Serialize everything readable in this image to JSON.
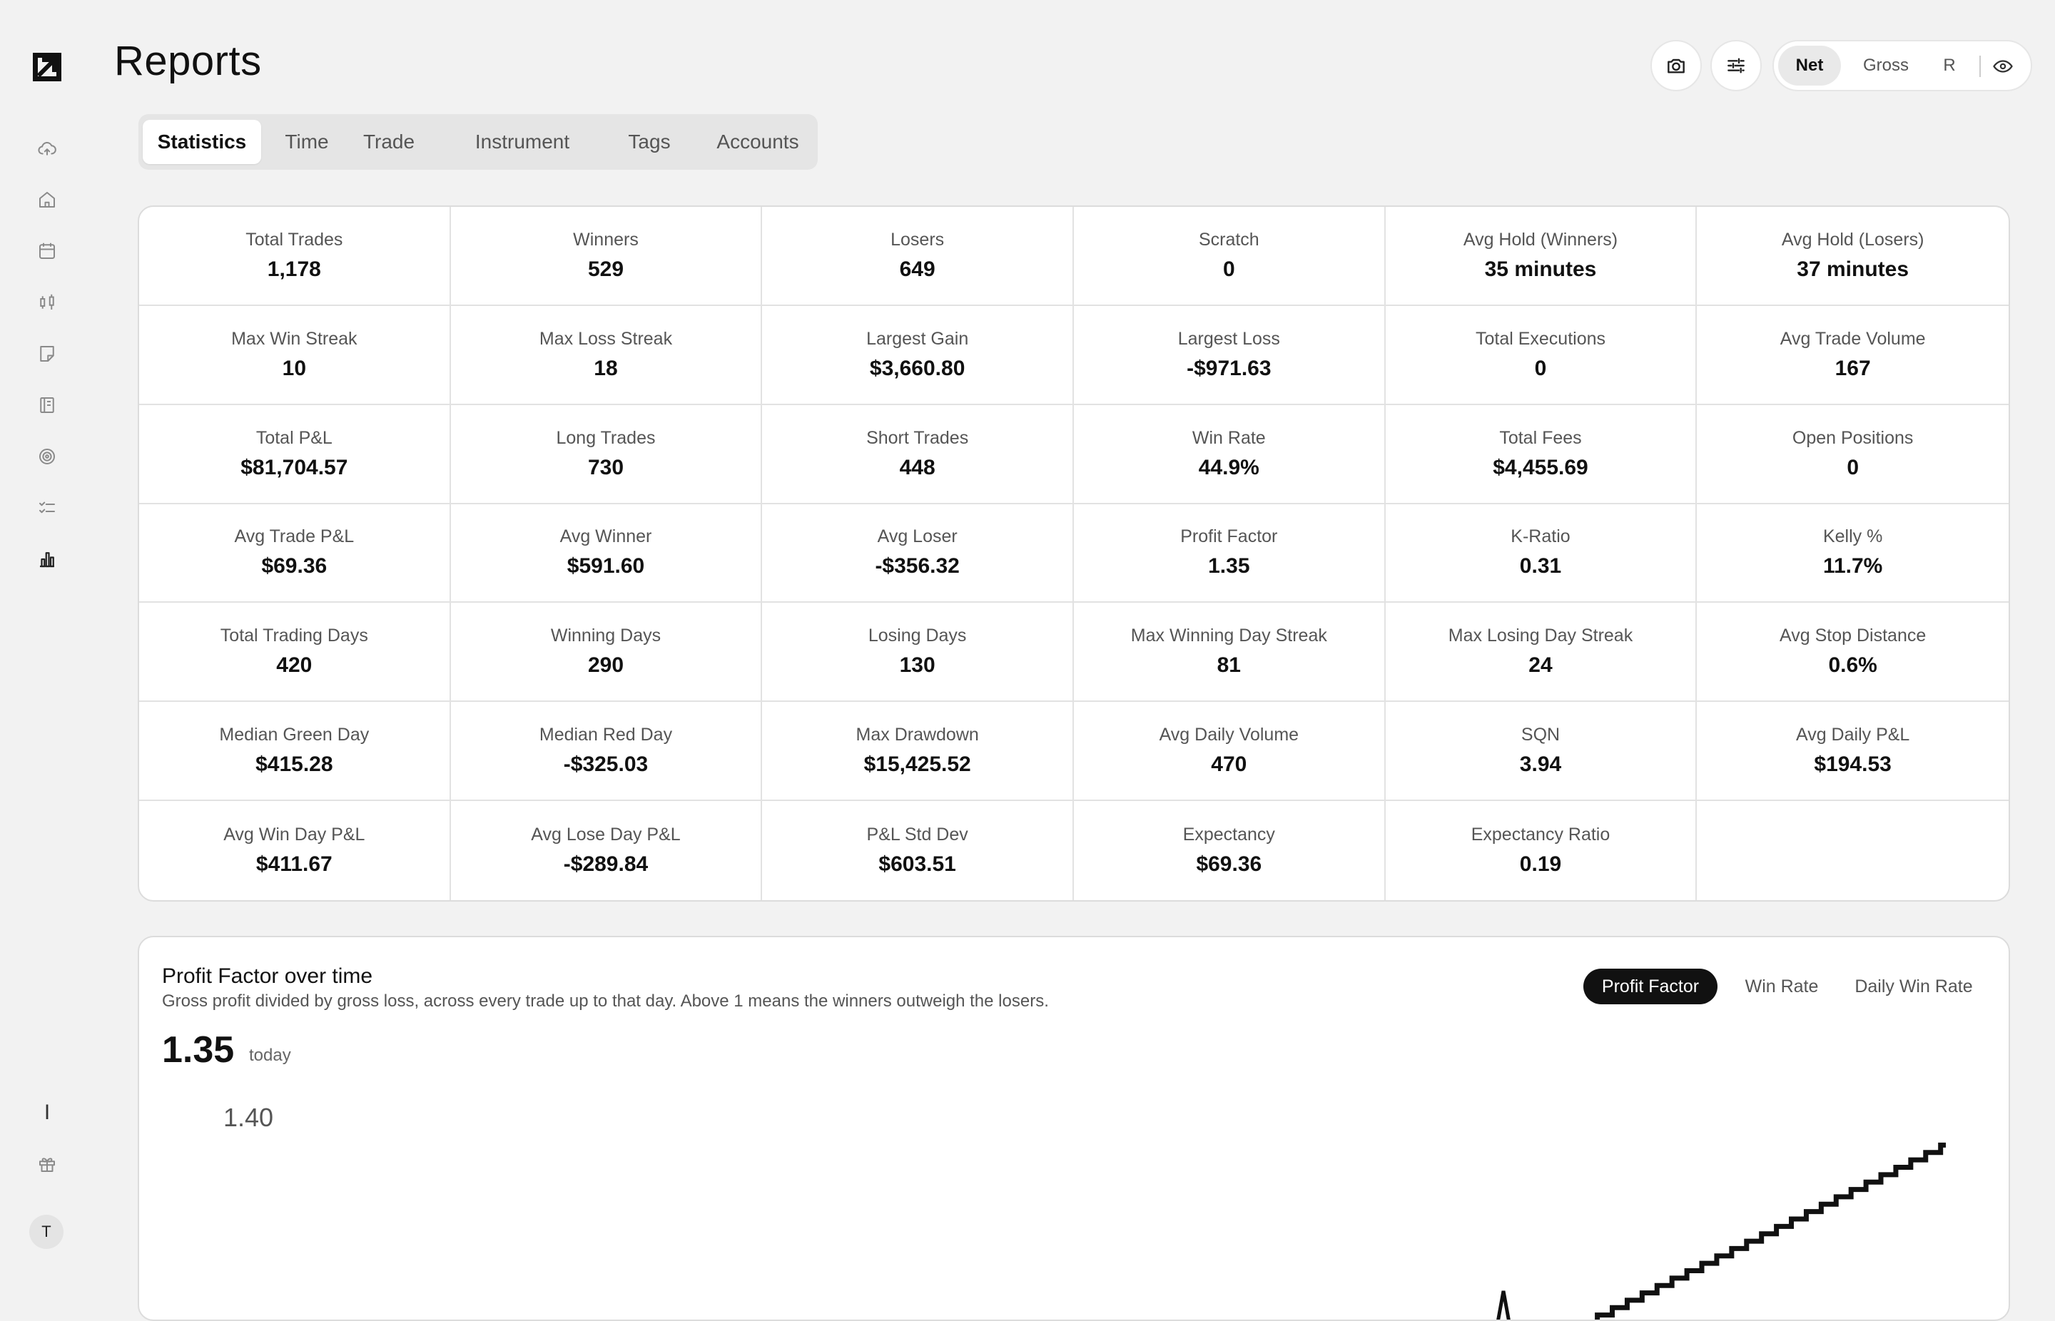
{
  "header": {
    "title": "Reports",
    "mode_options": [
      "Net",
      "Gross",
      "R"
    ],
    "mode_selected": "Net"
  },
  "sidebar": {
    "items": [
      {
        "icon": "cloud-upload-icon"
      },
      {
        "icon": "home-icon"
      },
      {
        "icon": "calendar-icon"
      },
      {
        "icon": "candlestick-icon"
      },
      {
        "icon": "note-icon"
      },
      {
        "icon": "notebook-icon"
      },
      {
        "icon": "target-icon"
      },
      {
        "icon": "checklist-icon"
      },
      {
        "icon": "bar-chart-icon",
        "active": true
      }
    ],
    "bottom": {
      "marker": "I",
      "gift": "gift-icon",
      "avatar_initial": "T"
    }
  },
  "tabs": [
    "Statistics",
    "Time",
    "Trade",
    "Instrument",
    "Tags",
    "Accounts"
  ],
  "active_tab": "Statistics",
  "stats": [
    {
      "label": "Total Trades",
      "value": "1,178"
    },
    {
      "label": "Winners",
      "value": "529"
    },
    {
      "label": "Losers",
      "value": "649"
    },
    {
      "label": "Scratch",
      "value": "0"
    },
    {
      "label": "Avg Hold (Winners)",
      "value": "35 minutes"
    },
    {
      "label": "Avg Hold (Losers)",
      "value": "37 minutes"
    },
    {
      "label": "Max Win Streak",
      "value": "10"
    },
    {
      "label": "Max Loss Streak",
      "value": "18"
    },
    {
      "label": "Largest Gain",
      "value": "$3,660.80"
    },
    {
      "label": "Largest Loss",
      "value": "-$971.63"
    },
    {
      "label": "Total Executions",
      "value": "0"
    },
    {
      "label": "Avg Trade Volume",
      "value": "167"
    },
    {
      "label": "Total P&L",
      "value": "$81,704.57"
    },
    {
      "label": "Long Trades",
      "value": "730"
    },
    {
      "label": "Short Trades",
      "value": "448"
    },
    {
      "label": "Win Rate",
      "value": "44.9%"
    },
    {
      "label": "Total Fees",
      "value": "$4,455.69"
    },
    {
      "label": "Open Positions",
      "value": "0"
    },
    {
      "label": "Avg Trade P&L",
      "value": "$69.36"
    },
    {
      "label": "Avg Winner",
      "value": "$591.60"
    },
    {
      "label": "Avg Loser",
      "value": "-$356.32"
    },
    {
      "label": "Profit Factor",
      "value": "1.35"
    },
    {
      "label": "K-Ratio",
      "value": "0.31"
    },
    {
      "label": "Kelly %",
      "value": "11.7%"
    },
    {
      "label": "Total Trading Days",
      "value": "420"
    },
    {
      "label": "Winning Days",
      "value": "290"
    },
    {
      "label": "Losing Days",
      "value": "130"
    },
    {
      "label": "Max Winning Day Streak",
      "value": "81"
    },
    {
      "label": "Max Losing Day Streak",
      "value": "24"
    },
    {
      "label": "Avg Stop Distance",
      "value": "0.6%"
    },
    {
      "label": "Median Green Day",
      "value": "$415.28"
    },
    {
      "label": "Median Red Day",
      "value": "-$325.03"
    },
    {
      "label": "Max Drawdown",
      "value": "$15,425.52"
    },
    {
      "label": "Avg Daily Volume",
      "value": "470"
    },
    {
      "label": "SQN",
      "value": "3.94"
    },
    {
      "label": "Avg Daily P&L",
      "value": "$194.53"
    },
    {
      "label": "Avg Win Day P&L",
      "value": "$411.67"
    },
    {
      "label": "Avg Lose Day P&L",
      "value": "-$289.84"
    },
    {
      "label": "P&L Std Dev",
      "value": "$603.51"
    },
    {
      "label": "Expectancy",
      "value": "$69.36"
    },
    {
      "label": "Expectancy Ratio",
      "value": "0.19"
    },
    {
      "label": "",
      "value": ""
    }
  ],
  "chart": {
    "title": "Profit Factor over time",
    "subtitle": "Gross profit divided by gross loss, across every trade up to that day. Above 1 means the winners outweigh the losers.",
    "current_value": "1.35",
    "current_label": "today",
    "toggles": [
      "Profit Factor",
      "Win Rate",
      "Daily Win Rate"
    ],
    "active_toggle": "Profit Factor",
    "y_tick": "1.40"
  },
  "chart_data": {
    "type": "line",
    "title": "Profit Factor over time",
    "ylabel": "",
    "y_ticks": [
      1.4
    ],
    "series": [
      {
        "values": [
          1.26,
          1.265,
          1.27,
          1.275,
          1.28,
          1.285,
          1.29,
          1.295,
          1.3,
          1.305,
          1.31,
          1.315,
          1.32,
          1.325,
          1.33,
          1.335,
          1.34,
          1.345,
          1.35,
          1.355,
          1.36,
          1.365,
          1.37,
          1.375,
          1.38
        ]
      }
    ],
    "grid": false,
    "legend": "none",
    "colors": {
      "line": "#111111"
    }
  }
}
